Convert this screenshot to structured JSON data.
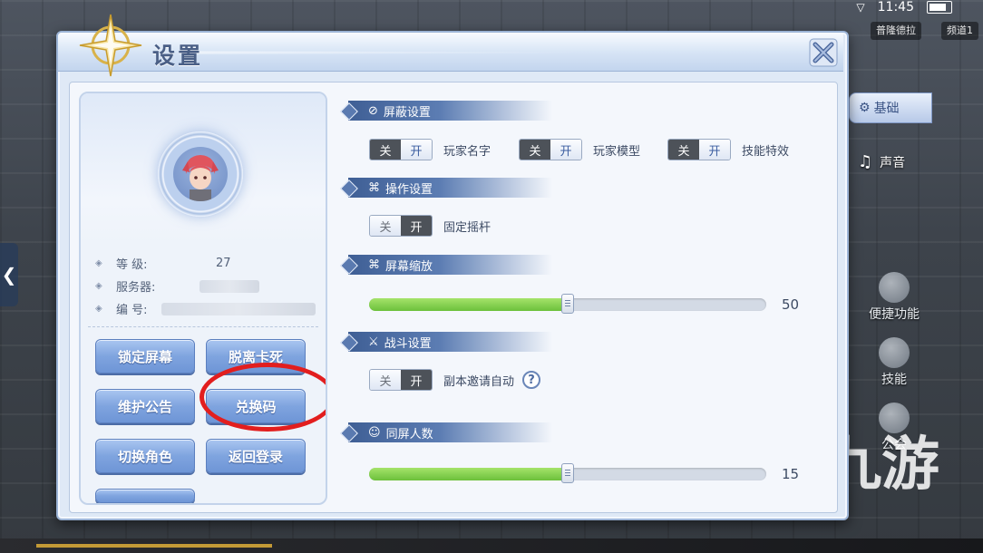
{
  "status_bar": {
    "time": "11:45"
  },
  "map_tabs": [
    "普隆德拉",
    "频道1"
  ],
  "side_menu": [
    "便捷功能",
    "技能",
    "公会"
  ],
  "dialog": {
    "title": "设置"
  },
  "profile": {
    "level_label": "等  级:",
    "level_value": "27",
    "server_label": "服务器:",
    "id_label": "编  号:"
  },
  "profile_buttons": {
    "lock_screen": "锁定屏幕",
    "unstuck": "脱离卡死",
    "maintenance": "维护公告",
    "redeem_code": "兑换码",
    "switch_role": "切换角色",
    "back_login": "返回登录"
  },
  "sections": {
    "shield": {
      "title": "屏蔽设置",
      "icon": "ban-icon"
    },
    "operation": {
      "title": "操作设置",
      "icon": "gamepad-icon"
    },
    "zoom": {
      "title": "屏幕缩放",
      "icon": "gamepad-icon"
    },
    "battle": {
      "title": "战斗设置",
      "icon": "sword-icon"
    },
    "same_screen": {
      "title": "同屏人数",
      "icon": "people-icon"
    }
  },
  "toggles": {
    "off_label": "关",
    "on_label": "开",
    "player_name": {
      "label": "玩家名字",
      "state": "on"
    },
    "player_model": {
      "label": "玩家模型",
      "state": "on"
    },
    "skill_effect": {
      "label": "技能特效",
      "state": "on"
    },
    "fixed_joystick": {
      "label": "固定摇杆",
      "state": "off"
    },
    "dungeon_invite": {
      "label": "副本邀请自动",
      "state": "off"
    }
  },
  "help_mark": "?",
  "sliders": {
    "zoom": {
      "value": "50",
      "fraction": 0.5
    },
    "same_screen": {
      "value": "15",
      "fraction": 0.5
    }
  },
  "tabs": {
    "basic": "基础",
    "sound": "声音"
  },
  "colors": {
    "accent": "#6e95d6",
    "highlight_circle": "#e21e1e",
    "slider_fill": "#6cc03b"
  }
}
